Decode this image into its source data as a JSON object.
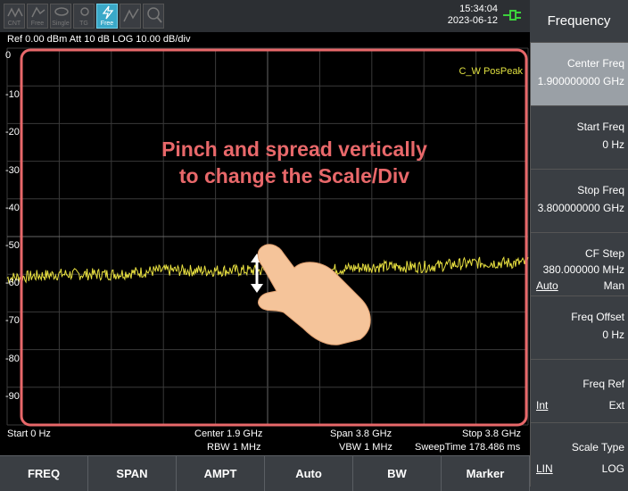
{
  "toolbar": {
    "icons": [
      {
        "name": "cont-sweep-icon",
        "label": "CNT"
      },
      {
        "name": "trigger-icon",
        "label": "Free"
      },
      {
        "name": "single-sweep-icon",
        "label": "Single"
      },
      {
        "name": "tg-icon",
        "label": "TG"
      },
      {
        "name": "free-run-icon",
        "label": "Free"
      },
      {
        "name": "marker-peak-icon",
        "label": ""
      },
      {
        "name": "zoom-icon",
        "label": ""
      }
    ],
    "time": "15:34:04",
    "date": "2023-06-12"
  },
  "header": {
    "ref_line": "Ref 0.00 dBm  Att 10 dB  LOG 10.00 dB/div"
  },
  "plot": {
    "trace_label": "C_W PosPeak",
    "y_labels": [
      "0",
      "-10",
      "-20",
      "-30",
      "-40",
      "-50",
      "-60",
      "-70",
      "-80",
      "-90"
    ],
    "gesture_line1": "Pinch and spread vertically",
    "gesture_line2": "to change the Scale/Div",
    "trace_color": "#e8e040",
    "highlight_color": "#e8686a"
  },
  "chart_data": {
    "type": "line",
    "x_unit": "GHz",
    "xlim": [
      0,
      3.8
    ],
    "ylim": [
      -100,
      0
    ],
    "x": [
      0,
      0.38,
      0.76,
      1.14,
      1.52,
      1.9,
      2.28,
      2.66,
      3.04,
      3.42,
      3.8
    ],
    "y": [
      -61,
      -60,
      -60,
      -59,
      -59,
      -59,
      -59,
      -58,
      -58,
      -57,
      -57
    ]
  },
  "bottom_info": {
    "start": "Start 0 Hz",
    "center": "Center 1.9 GHz",
    "rbw": "RBW 1 MHz",
    "span": "Span 3.8 GHz",
    "vbw": "VBW 1 MHz",
    "stop": "Stop 3.8 GHz",
    "sweep_time": "SweepTime 178.486 ms"
  },
  "softkeys": [
    "FREQ",
    "SPAN",
    "AMPT",
    "Auto",
    "BW",
    "Marker"
  ],
  "menu": {
    "title": "Frequency",
    "items": [
      {
        "label": "Center Freq",
        "value": "1.900000000 GHz"
      },
      {
        "label": "Start Freq",
        "value": "0 Hz"
      },
      {
        "label": "Stop Freq",
        "value": "3.800000000 GHz"
      },
      {
        "label": "CF Step",
        "value": "380.000000 MHz",
        "opt_left": "Auto",
        "opt_right": "Man"
      },
      {
        "label": "Freq Offset",
        "value": "0 Hz"
      },
      {
        "label": "Freq Ref",
        "opt_left": "Int",
        "opt_right": "Ext"
      },
      {
        "label": "Scale Type",
        "opt_left": "LIN",
        "opt_right": "LOG"
      }
    ]
  }
}
